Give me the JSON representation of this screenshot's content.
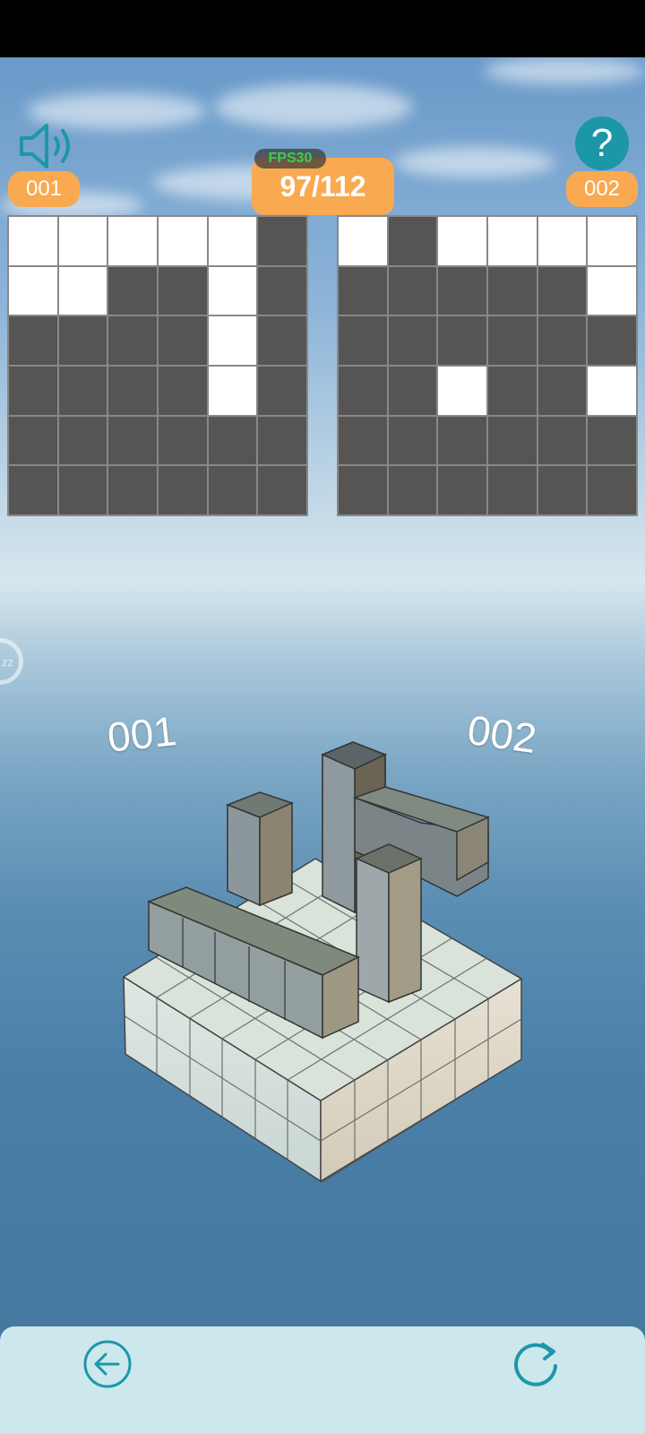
{
  "hud": {
    "left_counter": "001",
    "right_counter": "002",
    "score": "97/112",
    "fps": "FPS30",
    "sound_icon": "speaker-icon",
    "help_icon": "question-icon",
    "side_knob_text": "zz"
  },
  "grids": {
    "left": [
      [
        0,
        0,
        0,
        0,
        0,
        1
      ],
      [
        0,
        0,
        1,
        1,
        0,
        1
      ],
      [
        1,
        1,
        1,
        1,
        0,
        1
      ],
      [
        1,
        1,
        1,
        1,
        0,
        1
      ],
      [
        1,
        1,
        1,
        1,
        1,
        1
      ],
      [
        1,
        1,
        1,
        1,
        1,
        1
      ]
    ],
    "right": [
      [
        0,
        1,
        0,
        0,
        0,
        0
      ],
      [
        1,
        1,
        1,
        1,
        1,
        0
      ],
      [
        1,
        1,
        1,
        1,
        1,
        1
      ],
      [
        1,
        1,
        0,
        1,
        1,
        0
      ],
      [
        1,
        1,
        1,
        1,
        1,
        1
      ],
      [
        1,
        1,
        1,
        1,
        1,
        1
      ]
    ]
  },
  "scene": {
    "label_left": "001",
    "label_right": "002"
  },
  "bottom": {
    "back_icon": "back-arrow-icon",
    "reset_icon": "refresh-icon"
  },
  "colors": {
    "accent": "#f9a94f",
    "filled_cell": "#575454",
    "help_icon": "#1c97a8",
    "fps_text": "#39d04a"
  }
}
